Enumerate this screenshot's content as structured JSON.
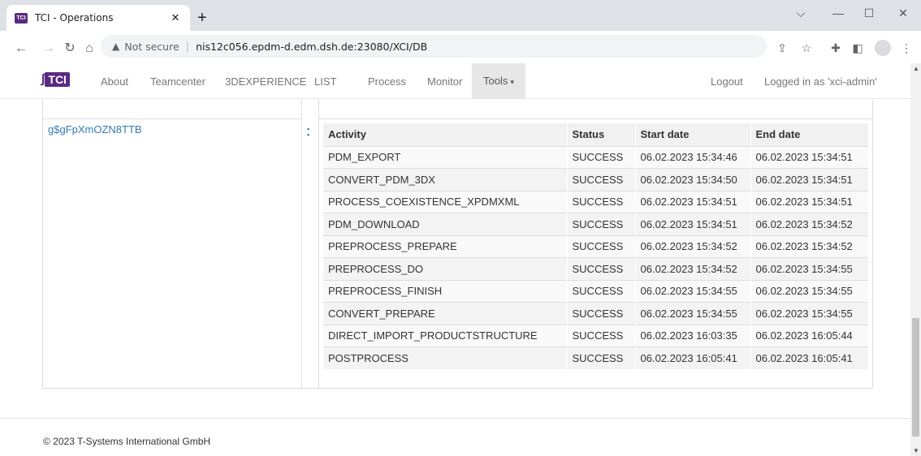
{
  "browser": {
    "tab_title": "TCI - Operations",
    "favicon_text": "TCI",
    "not_secure": "Not secure",
    "url": "nis12c056.epdm-d.edm.dsh.de:23080/XCI/DB"
  },
  "navbar": {
    "brand": "TCI",
    "links": [
      "About",
      "Teamcenter",
      "3DEXPERIENCE",
      "LIST",
      "Process",
      "Monitor"
    ],
    "tools": "Tools",
    "logout": "Logout",
    "logged_in": "Logged in as 'xci-admin'"
  },
  "record_id": "g$gFpXmOZN8TTB",
  "table": {
    "headers": [
      "Activity",
      "Status",
      "Start date",
      "End date"
    ],
    "rows": [
      [
        "PDM_EXPORT",
        "SUCCESS",
        "06.02.2023 15:34:46",
        "06.02.2023 15:34:51"
      ],
      [
        "CONVERT_PDM_3DX",
        "SUCCESS",
        "06.02.2023 15:34:50",
        "06.02.2023 15:34:51"
      ],
      [
        "PROCESS_COEXISTENCE_XPDMXML",
        "SUCCESS",
        "06.02.2023 15:34:51",
        "06.02.2023 15:34:51"
      ],
      [
        "PDM_DOWNLOAD",
        "SUCCESS",
        "06.02.2023 15:34:51",
        "06.02.2023 15:34:52"
      ],
      [
        "PREPROCESS_PREPARE",
        "SUCCESS",
        "06.02.2023 15:34:52",
        "06.02.2023 15:34:52"
      ],
      [
        "PREPROCESS_DO",
        "SUCCESS",
        "06.02.2023 15:34:52",
        "06.02.2023 15:34:55"
      ],
      [
        "PREPROCESS_FINISH",
        "SUCCESS",
        "06.02.2023 15:34:55",
        "06.02.2023 15:34:55"
      ],
      [
        "CONVERT_PREPARE",
        "SUCCESS",
        "06.02.2023 15:34:55",
        "06.02.2023 15:34:55"
      ],
      [
        "DIRECT_IMPORT_PRODUCTSTRUCTURE",
        "SUCCESS",
        "06.02.2023 16:03:35",
        "06.02.2023 16:05:44"
      ],
      [
        "POSTPROCESS",
        "SUCCESS",
        "06.02.2023 16:05:41",
        "06.02.2023 16:05:41"
      ]
    ]
  },
  "footer": "© 2023 T-Systems International GmbH",
  "colors": {
    "brand": "#5a2a82",
    "link": "#337ab7"
  }
}
